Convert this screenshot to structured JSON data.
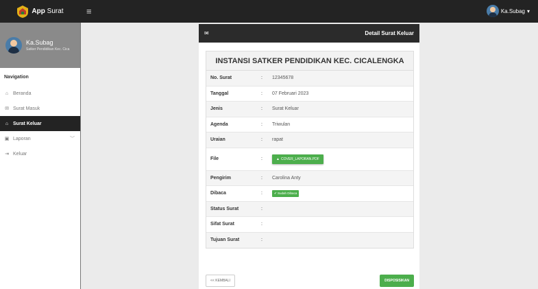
{
  "topbar": {
    "brand_bold": "App",
    "brand_rest": " Surat",
    "user_label": "Ka.Subag"
  },
  "sidebar": {
    "profile_name": "Ka.Subag",
    "profile_sub": "Satker Pendidikan Kec. Cica",
    "nav_heading": "Navigation",
    "items": [
      {
        "label": "Beranda",
        "icon": "home-icon"
      },
      {
        "label": "Surat Masuk",
        "icon": "mail-icon"
      },
      {
        "label": "Surat Keluar",
        "icon": "home-icon",
        "active": true
      },
      {
        "label": "Laporan",
        "icon": "report-icon"
      },
      {
        "label": "Keluar",
        "icon": "logout-icon"
      }
    ]
  },
  "card": {
    "header_title": "Detail Surat Keluar",
    "detail_title": "INSTANSI SATKER PENDIDIKAN KEC. CICALENGKA",
    "separator": ":",
    "rows": [
      {
        "label": "No. Surat",
        "value": "12345678"
      },
      {
        "label": "Tanggal",
        "value": "07 Februari 2023"
      },
      {
        "label": "Jenis",
        "value": "Surat Keluar"
      },
      {
        "label": "Agenda",
        "value": "Triwulan"
      },
      {
        "label": "Uraian",
        "value": "rapat"
      },
      {
        "label": "File",
        "value": "COVER_LAPORAN.PDF"
      },
      {
        "label": "Pengirim",
        "value": "Carolina Anty"
      },
      {
        "label": "Dibaca",
        "value": "Sudah Dibaca"
      },
      {
        "label": "Status Surat",
        "value": ""
      },
      {
        "label": "Sifat Surat",
        "value": ""
      },
      {
        "label": "Tujuan Surat",
        "value": ""
      }
    ],
    "back_label": "<< KEMBALI",
    "dispo_label": "DISPOSISIKAN"
  },
  "colors": {
    "dark": "#232323",
    "success": "#4cae4c",
    "profile_bg": "#8a8a8a"
  }
}
